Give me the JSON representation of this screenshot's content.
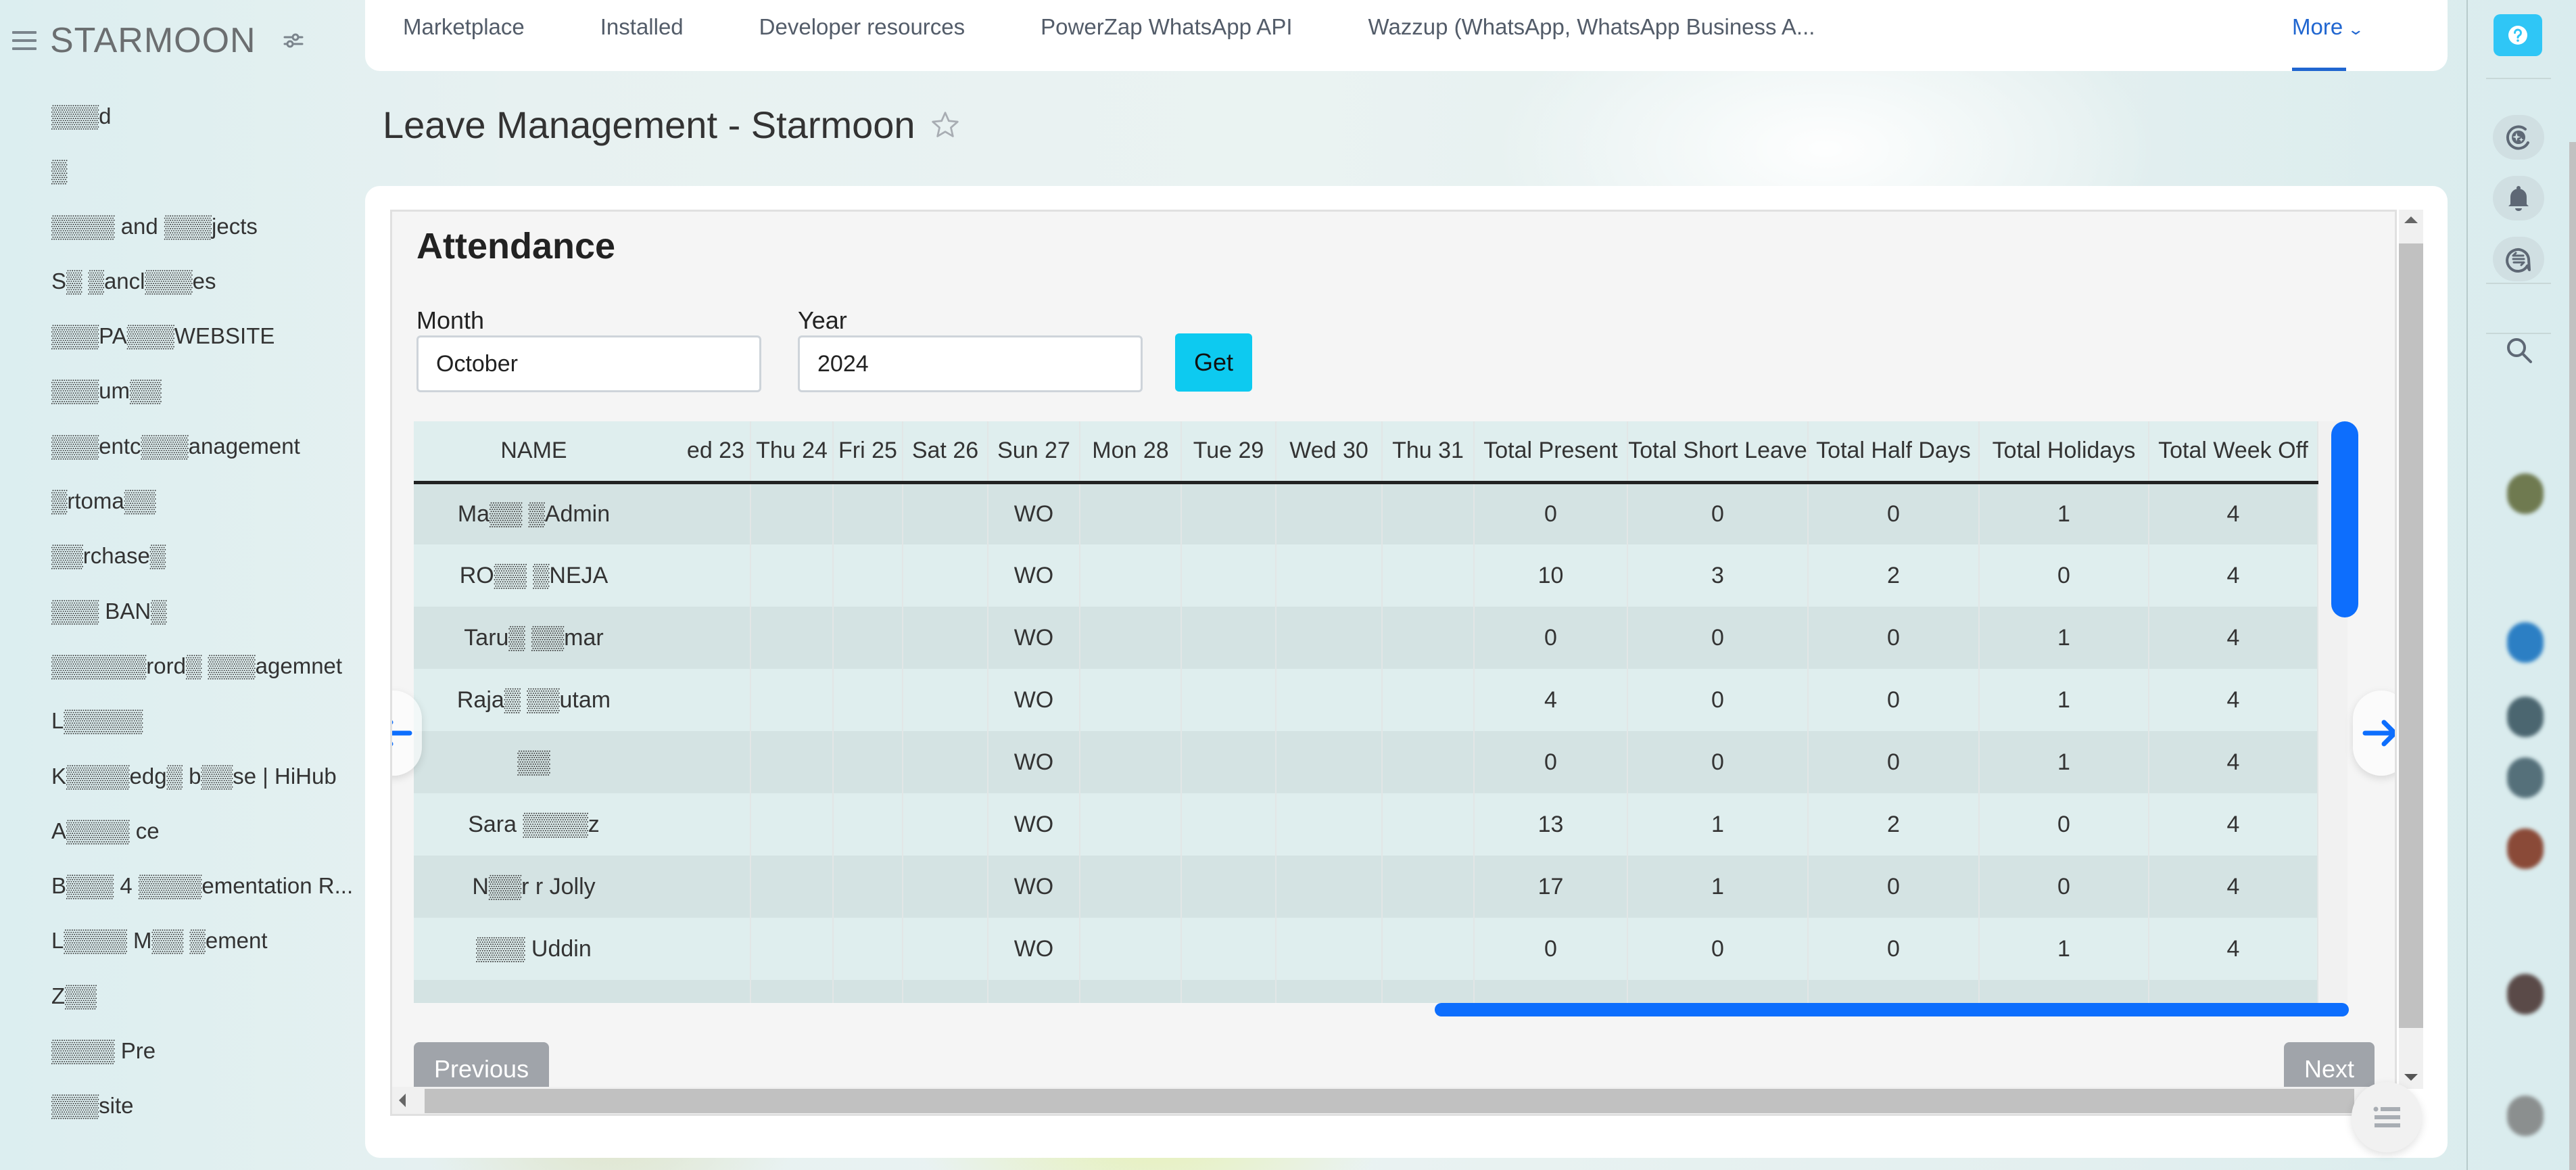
{
  "sidebar": {
    "logo": "STARMOON",
    "items": [
      {
        "label": "▒▒▒d"
      },
      {
        "label": "▒"
      },
      {
        "label": "▒▒▒▒ and ▒▒▒jects"
      },
      {
        "label": "S▒ ▒ancl▒▒▒es"
      },
      {
        "label": "▒▒▒PA▒▒▒WEBSITE"
      },
      {
        "label": "▒▒▒um▒▒"
      },
      {
        "label": "▒▒▒entc▒▒▒anagement"
      },
      {
        "label": "▒rtoma▒▒"
      },
      {
        "label": "▒▒rchase▒"
      },
      {
        "label": "▒▒▒ BAN▒"
      },
      {
        "label": "▒▒▒▒▒▒rord▒ ▒▒▒agemnet"
      },
      {
        "label": "L▒▒▒▒▒"
      },
      {
        "label": "K▒▒▒▒edg▒ b▒▒se | HiHub"
      },
      {
        "label": "A▒▒▒▒ ce"
      },
      {
        "label": "B▒▒▒ 4 ▒▒▒▒ementation R..."
      },
      {
        "label": "L▒▒▒▒ M▒▒ ▒ement"
      },
      {
        "label": "Z▒▒"
      },
      {
        "label": "▒▒▒▒ Pre"
      },
      {
        "label": "▒▒▒site"
      }
    ]
  },
  "topnav": {
    "links": [
      "Marketplace",
      "Installed",
      "Developer resources",
      "PowerZap WhatsApp API",
      "Wazzup (WhatsApp, WhatsApp Business A..."
    ],
    "more_label": "More"
  },
  "page": {
    "title": "Leave Management - Starmoon"
  },
  "attendance": {
    "title": "Attendance",
    "month_label": "Month",
    "month_value": "October",
    "year_label": "Year",
    "year_value": "2024",
    "get_label": "Get",
    "columns": [
      "NAME",
      "ed 23",
      "Thu 24",
      "Fri 25",
      "Sat 26",
      "Sun 27",
      "Mon 28",
      "Tue 29",
      "Wed 30",
      "Thu 31",
      "Total Present",
      "Total Short Leave",
      "Total Half Days",
      "Total Holidays",
      "Total Week Off"
    ],
    "rows": [
      {
        "name": "Ma▒▒ ▒Admin",
        "days": [
          "",
          "",
          "",
          "",
          "WO",
          "",
          "",
          "",
          ""
        ],
        "totals": [
          "0",
          "0",
          "0",
          "1",
          "4"
        ]
      },
      {
        "name": "RO▒▒ ▒NEJA",
        "days": [
          "",
          "",
          "",
          "",
          "WO",
          "",
          "",
          "",
          ""
        ],
        "totals": [
          "10",
          "3",
          "2",
          "0",
          "4"
        ]
      },
      {
        "name": "Taru▒ ▒▒mar",
        "days": [
          "",
          "",
          "",
          "",
          "WO",
          "",
          "",
          "",
          ""
        ],
        "totals": [
          "0",
          "0",
          "0",
          "1",
          "4"
        ]
      },
      {
        "name": "Raja▒ ▒▒utam",
        "days": [
          "",
          "",
          "",
          "",
          "WO",
          "",
          "",
          "",
          ""
        ],
        "totals": [
          "4",
          "0",
          "0",
          "1",
          "4"
        ]
      },
      {
        "name": "▒▒",
        "days": [
          "",
          "",
          "",
          "",
          "WO",
          "",
          "",
          "",
          ""
        ],
        "totals": [
          "0",
          "0",
          "0",
          "1",
          "4"
        ]
      },
      {
        "name": "Sara ▒▒▒▒z",
        "days": [
          "",
          "",
          "",
          "",
          "WO",
          "",
          "",
          "",
          ""
        ],
        "totals": [
          "13",
          "1",
          "2",
          "0",
          "4"
        ]
      },
      {
        "name": "N▒▒r r Jolly",
        "days": [
          "",
          "",
          "",
          "",
          "WO",
          "",
          "",
          "",
          ""
        ],
        "totals": [
          "17",
          "1",
          "0",
          "0",
          "4"
        ]
      },
      {
        "name": "▒▒▒ Uddin",
        "days": [
          "",
          "",
          "",
          "",
          "WO",
          "",
          "",
          "",
          ""
        ],
        "totals": [
          "0",
          "0",
          "0",
          "1",
          "4"
        ]
      }
    ],
    "previous_label": "Previous",
    "next_label": "Next"
  },
  "colors": {
    "accent": "#0d6efd",
    "get_button": "#0dcaf0",
    "help_button": "#2fc6f6",
    "nav_active": "#2066d0",
    "pager_button": "#a0a4aa"
  }
}
